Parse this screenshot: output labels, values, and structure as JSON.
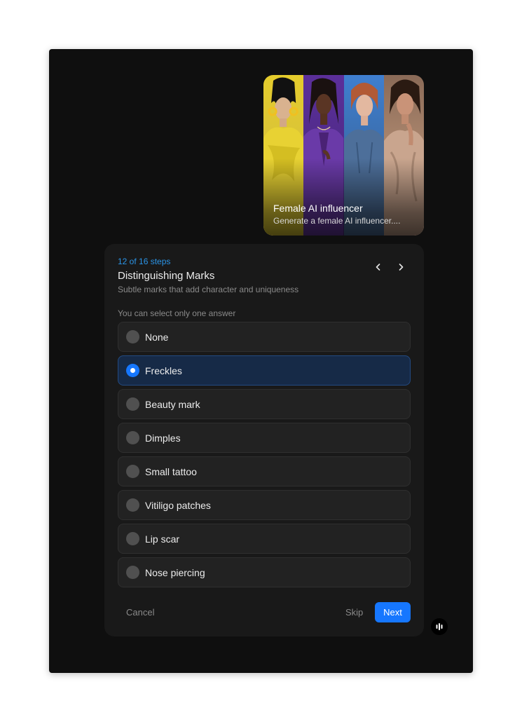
{
  "card": {
    "title": "Female AI influencer",
    "description": "Generate a female AI influencer...."
  },
  "question": {
    "step": "12 of 16 steps",
    "title": "Distinguishing Marks",
    "subtitle": "Subtle marks that add character and uniqueness",
    "hint": "You can select only one answer",
    "selected": "Freckles",
    "options": [
      "None",
      "Freckles",
      "Beauty mark",
      "Dimples",
      "Small tattoo",
      "Vitiligo patches",
      "Lip scar",
      "Nose piercing"
    ]
  },
  "actions": {
    "cancel": "Cancel",
    "skip": "Skip",
    "next": "Next"
  },
  "icons": {
    "prev": "chevron-left-icon",
    "next": "chevron-right-icon",
    "assistant": "audio-bars-icon"
  },
  "colors": {
    "accent": "#1677ff",
    "step_text": "#2b95e8",
    "background": "#0f0f0f",
    "panel": "#191919"
  }
}
